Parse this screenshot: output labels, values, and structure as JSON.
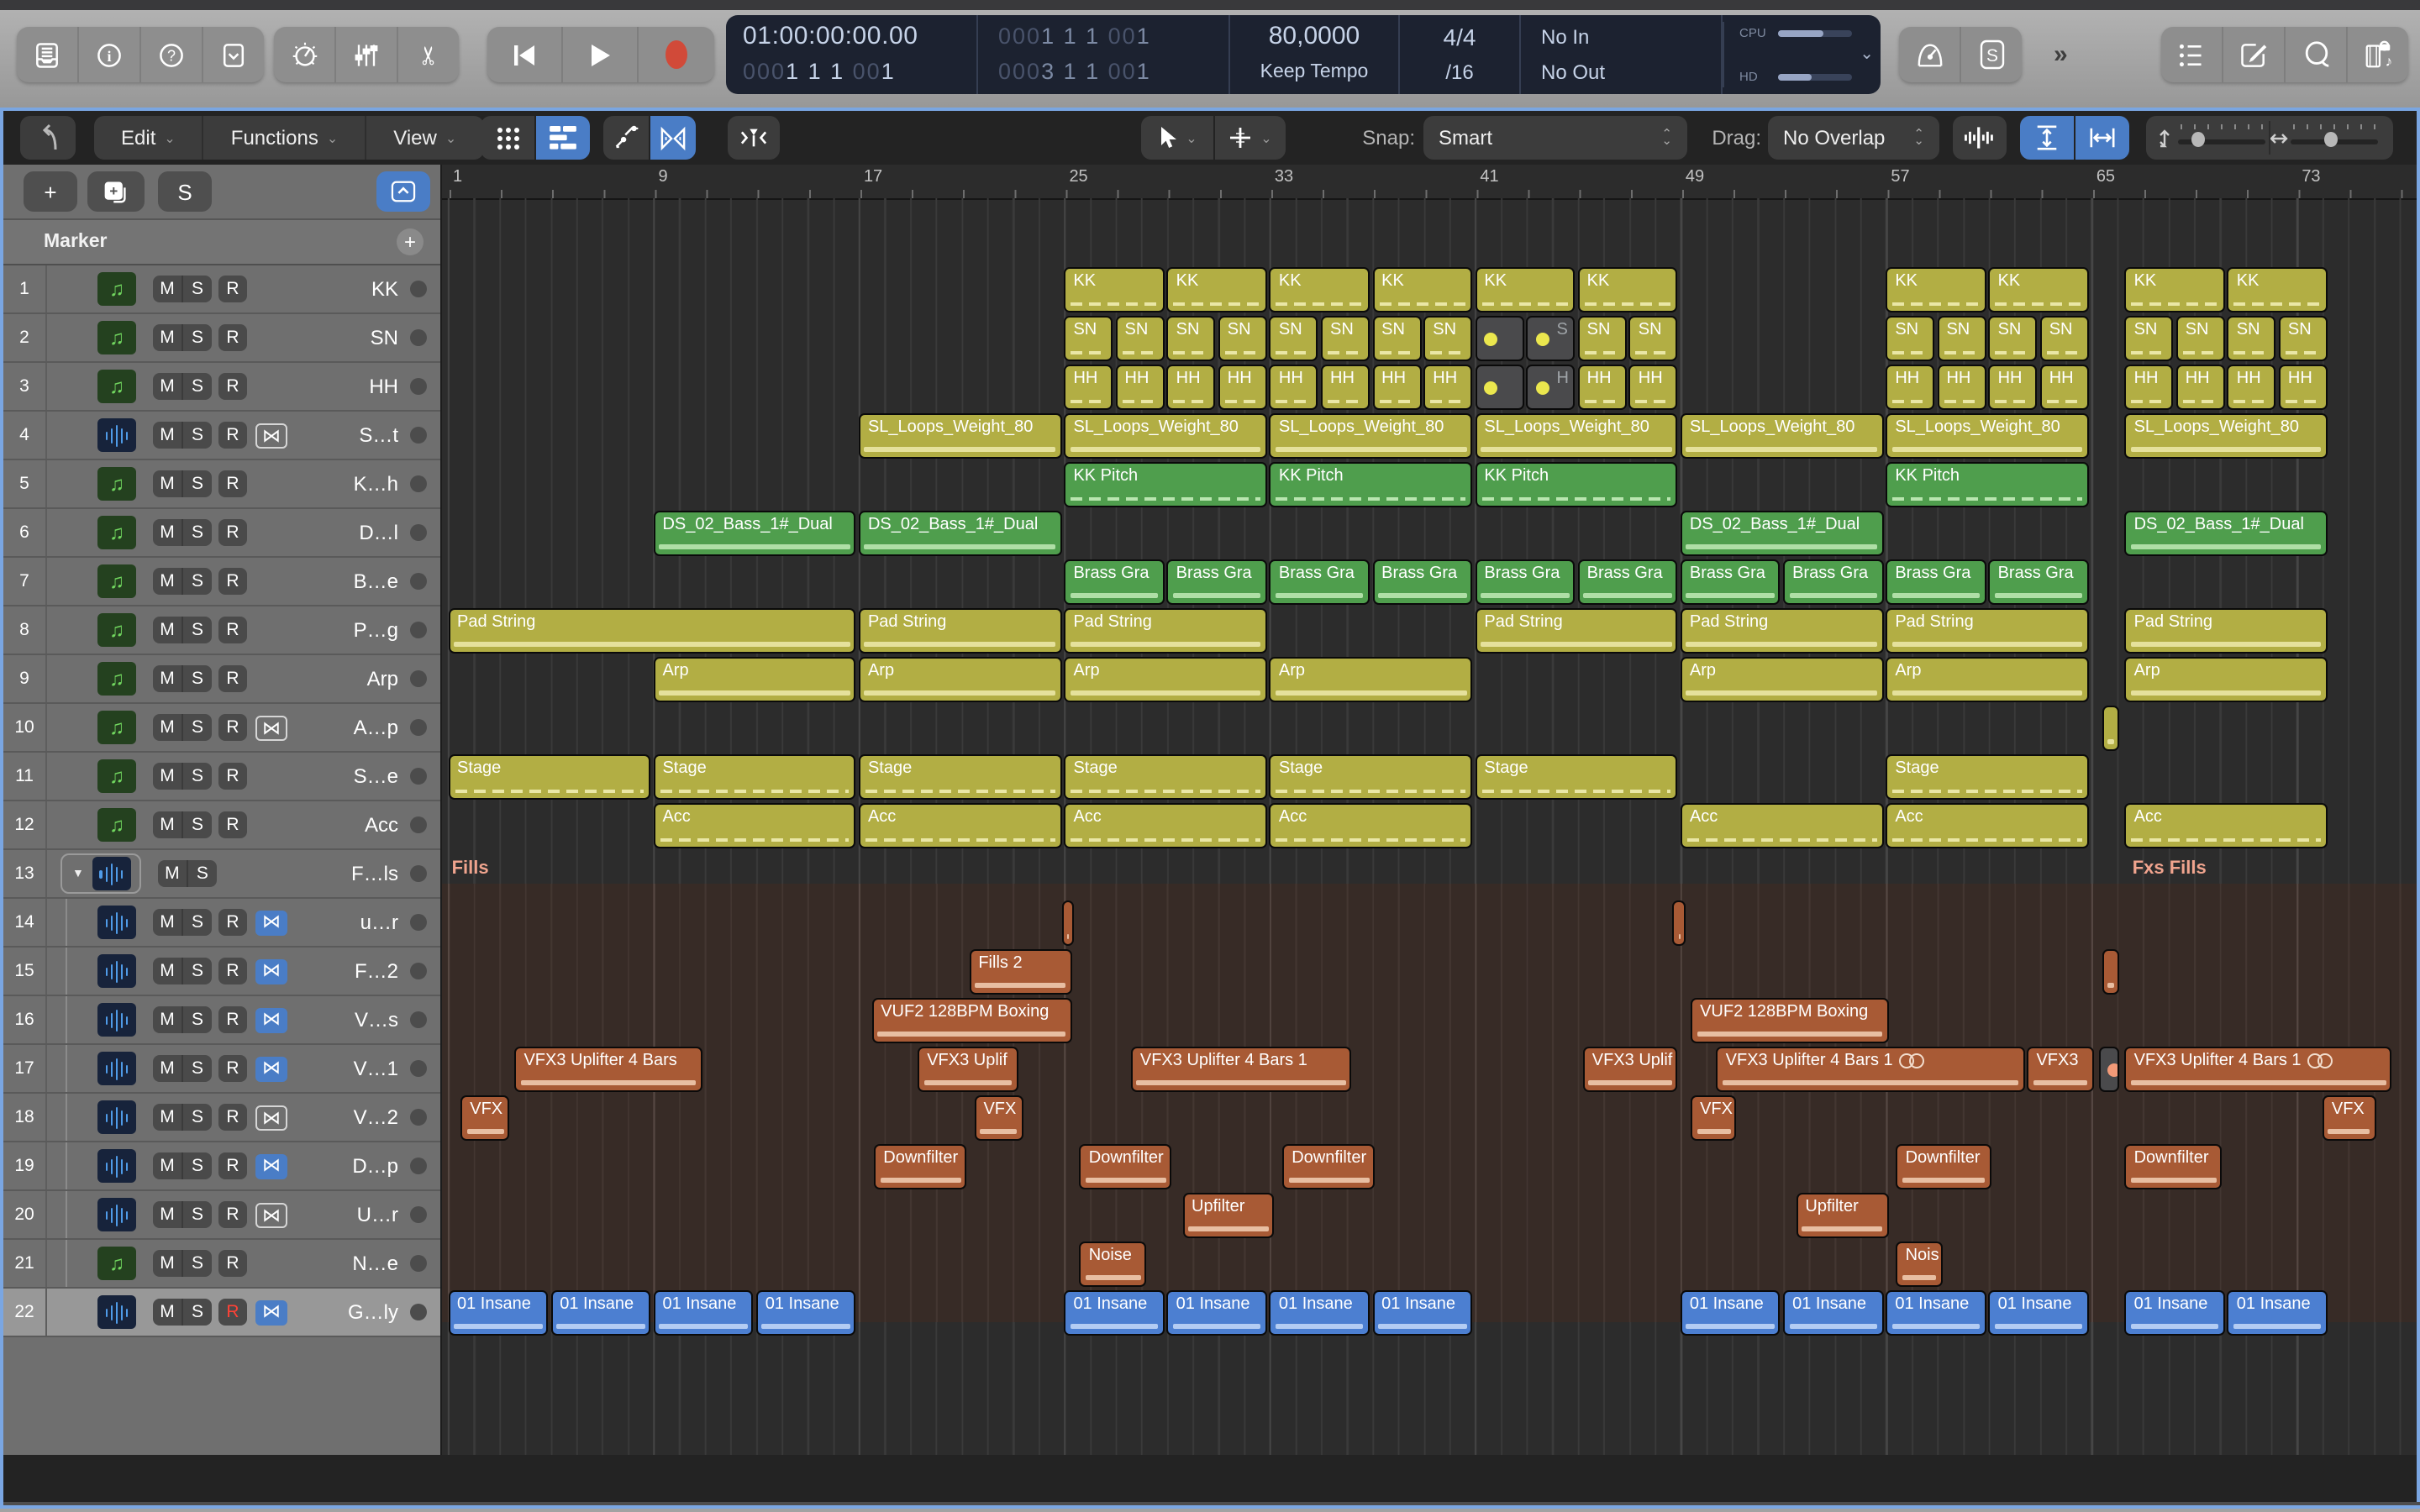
{
  "toolbar": {
    "overflow": "»",
    "solo_badge": "S",
    "lcd": {
      "time": "01:00:00:00.00",
      "pos": {
        "d1": "000",
        "b1": "1 1 1 ",
        "d2": "00",
        "b2": "1"
      },
      "alt_top": {
        "d1": "000",
        "m1": "1 1 1 ",
        "d2": "00",
        "m2": "1"
      },
      "alt_bot": {
        "d1": "000",
        "m1": "3 1 1 ",
        "d2": "00",
        "m2": "1"
      },
      "tempo_value": "80,0000",
      "tempo_mode": "Keep Tempo",
      "sig_top": "4/4",
      "sig_bottom": "/16",
      "io_in": "No In",
      "io_out": "No Out",
      "cpu_label": "CPU",
      "hd_label": "HD"
    }
  },
  "toolbar2": {
    "menus": [
      {
        "label": "Edit"
      },
      {
        "label": "Functions"
      },
      {
        "label": "View"
      }
    ],
    "snap_label": "Snap:",
    "snap_value": "Smart",
    "drag_label": "Drag:",
    "drag_value": "No Overlap"
  },
  "panel": {
    "marker_label": "Marker"
  },
  "ruler": {
    "bar_numbers": [
      1,
      9,
      17,
      25,
      33,
      41,
      49,
      57,
      65,
      73
    ]
  },
  "arrange": {
    "bar_width": 15.28,
    "first_bar_x": 3.5,
    "folder_labels": [
      {
        "text": "Fills",
        "bar": 1.15
      },
      {
        "text": "Fxs Fills",
        "bar": 66.6
      }
    ]
  },
  "colors": {
    "accent_blue": "#4a7dc6",
    "focus_border": "#7aa6e2",
    "clip_yellow": "#b2ae44",
    "clip_green": "#4f9e4d",
    "clip_rust": "#a85a35",
    "clip_blue": "#4c7fd1",
    "muted_dot_yellow": "#ebe74e",
    "muted_dot_orange": "#f29a78",
    "record_red": "#ff4236"
  },
  "tracks": [
    {
      "num": 1,
      "name": "KK",
      "kind": "midi",
      "r": true,
      "cc": "y",
      "st": "dash",
      "clips": [
        {
          "s": 25,
          "e": 29,
          "l": "KK"
        },
        {
          "s": 29,
          "e": 33,
          "l": "KK"
        },
        {
          "s": 33,
          "e": 37,
          "l": "KK"
        },
        {
          "s": 37,
          "e": 41,
          "l": "KK"
        },
        {
          "s": 41,
          "e": 45,
          "l": "KK"
        },
        {
          "s": 45,
          "e": 49,
          "l": "KK"
        },
        {
          "s": 57,
          "e": 61,
          "l": "KK"
        },
        {
          "s": 61,
          "e": 65,
          "l": "KK"
        },
        {
          "s": 66.3,
          "e": 70.3,
          "l": "KK"
        },
        {
          "s": 70.3,
          "e": 74.3,
          "l": "KK"
        }
      ]
    },
    {
      "num": 2,
      "name": "SN",
      "kind": "midi",
      "r": true,
      "cc": "y",
      "st": "dash",
      "clips": [
        {
          "s": 25,
          "e": 27,
          "l": "SN"
        },
        {
          "s": 27,
          "e": 29,
          "l": "SN"
        },
        {
          "s": 29,
          "e": 31,
          "l": "SN"
        },
        {
          "s": 31,
          "e": 33,
          "l": "SN"
        },
        {
          "s": 33,
          "e": 35,
          "l": "SN"
        },
        {
          "s": 35,
          "e": 37,
          "l": "SN"
        },
        {
          "s": 37,
          "e": 39,
          "l": "SN"
        },
        {
          "s": 39,
          "e": 41,
          "l": "SN"
        },
        {
          "s": 41,
          "e": 43,
          "muted": true,
          "dot": "#ebe74e"
        },
        {
          "s": 43,
          "e": 45,
          "muted": true,
          "dot": "#ebe74e",
          "l": "S"
        },
        {
          "s": 45,
          "e": 47,
          "l": "SN"
        },
        {
          "s": 47,
          "e": 49,
          "l": "SN"
        },
        {
          "s": 57,
          "e": 59,
          "l": "SN"
        },
        {
          "s": 59,
          "e": 61,
          "l": "SN"
        },
        {
          "s": 61,
          "e": 63,
          "l": "SN"
        },
        {
          "s": 63,
          "e": 65,
          "l": "SN"
        },
        {
          "s": 66.3,
          "e": 68.3,
          "l": "SN"
        },
        {
          "s": 68.3,
          "e": 70.3,
          "l": "SN"
        },
        {
          "s": 70.3,
          "e": 72.3,
          "l": "SN"
        },
        {
          "s": 72.3,
          "e": 74.3,
          "l": "SN"
        }
      ]
    },
    {
      "num": 3,
      "name": "HH",
      "kind": "midi",
      "r": true,
      "cc": "y",
      "st": "dash",
      "clips": [
        {
          "s": 25,
          "e": 27,
          "l": "HH"
        },
        {
          "s": 27,
          "e": 29,
          "l": "HH"
        },
        {
          "s": 29,
          "e": 31,
          "l": "HH"
        },
        {
          "s": 31,
          "e": 33,
          "l": "HH"
        },
        {
          "s": 33,
          "e": 35,
          "l": "HH"
        },
        {
          "s": 35,
          "e": 37,
          "l": "HH"
        },
        {
          "s": 37,
          "e": 39,
          "l": "HH"
        },
        {
          "s": 39,
          "e": 41,
          "l": "HH"
        },
        {
          "s": 41,
          "e": 43,
          "muted": true,
          "dot": "#ebe74e"
        },
        {
          "s": 43,
          "e": 45,
          "muted": true,
          "dot": "#ebe74e",
          "l": "H"
        },
        {
          "s": 45,
          "e": 47,
          "l": "HH"
        },
        {
          "s": 47,
          "e": 49,
          "l": "HH"
        },
        {
          "s": 57,
          "e": 59,
          "l": "HH"
        },
        {
          "s": 59,
          "e": 61,
          "l": "HH"
        },
        {
          "s": 61,
          "e": 63,
          "l": "HH"
        },
        {
          "s": 63,
          "e": 65,
          "l": "HH"
        },
        {
          "s": 66.3,
          "e": 68.3,
          "l": "HH"
        },
        {
          "s": 68.3,
          "e": 70.3,
          "l": "HH"
        },
        {
          "s": 70.3,
          "e": 72.3,
          "l": "HH"
        },
        {
          "s": 72.3,
          "e": 74.3,
          "l": "HH"
        }
      ]
    },
    {
      "num": 4,
      "name": "S…t",
      "kind": "audio",
      "r": true,
      "flex": "plain",
      "cc": "y",
      "st": "wave",
      "clips": [
        {
          "s": 17,
          "e": 25,
          "l": "SL_Loops_Weight_80"
        },
        {
          "s": 25,
          "e": 33,
          "l": "SL_Loops_Weight_80"
        },
        {
          "s": 33,
          "e": 41,
          "l": "SL_Loops_Weight_80"
        },
        {
          "s": 41,
          "e": 49,
          "l": "SL_Loops_Weight_80"
        },
        {
          "s": 49,
          "e": 57,
          "l": "SL_Loops_Weight_80"
        },
        {
          "s": 57,
          "e": 65,
          "l": "SL_Loops_Weight_80"
        },
        {
          "s": 66.3,
          "e": 74.3,
          "l": "SL_Loops_Weight_80"
        }
      ]
    },
    {
      "num": 5,
      "name": "K…h",
      "kind": "midi",
      "r": true,
      "cc": "g",
      "st": "dash",
      "clips": [
        {
          "s": 25,
          "e": 33,
          "l": "KK Pitch"
        },
        {
          "s": 33,
          "e": 41,
          "l": "KK Pitch"
        },
        {
          "s": 41,
          "e": 49,
          "l": "KK Pitch"
        },
        {
          "s": 57,
          "e": 65,
          "l": "KK Pitch"
        }
      ]
    },
    {
      "num": 6,
      "name": "D…l",
      "kind": "midi",
      "r": true,
      "cc": "g",
      "st": "wave",
      "clips": [
        {
          "s": 9,
          "e": 17,
          "l": "DS_02_Bass_1#_Dual"
        },
        {
          "s": 17,
          "e": 25,
          "l": "DS_02_Bass_1#_Dual"
        },
        {
          "s": 49,
          "e": 57,
          "l": "DS_02_Bass_1#_Dual"
        },
        {
          "s": 66.3,
          "e": 74.3,
          "l": "DS_02_Bass_1#_Dual"
        }
      ]
    },
    {
      "num": 7,
      "name": "B…e",
      "kind": "midi",
      "r": true,
      "cc": "g",
      "st": "wave",
      "clips": [
        {
          "s": 25,
          "e": 29,
          "l": "Brass Gra"
        },
        {
          "s": 29,
          "e": 33,
          "l": "Brass Gra"
        },
        {
          "s": 33,
          "e": 37,
          "l": "Brass Gra"
        },
        {
          "s": 37,
          "e": 41,
          "l": "Brass Gra"
        },
        {
          "s": 41,
          "e": 45,
          "l": "Brass Gra"
        },
        {
          "s": 45,
          "e": 49,
          "l": "Brass Gra"
        },
        {
          "s": 49,
          "e": 53,
          "l": "Brass Gra"
        },
        {
          "s": 53,
          "e": 57,
          "l": "Brass Gra"
        },
        {
          "s": 57,
          "e": 61,
          "l": "Brass Gra"
        },
        {
          "s": 61,
          "e": 65,
          "l": "Brass Gra"
        }
      ]
    },
    {
      "num": 8,
      "name": "P…g",
      "kind": "midi",
      "r": true,
      "cc": "y",
      "st": "wave",
      "clips": [
        {
          "s": 1,
          "e": 17,
          "l": "Pad String"
        },
        {
          "s": 17,
          "e": 25,
          "l": "Pad String"
        },
        {
          "s": 25,
          "e": 33,
          "l": "Pad String"
        },
        {
          "s": 41,
          "e": 49,
          "l": "Pad String"
        },
        {
          "s": 49,
          "e": 57,
          "l": "Pad String"
        },
        {
          "s": 57,
          "e": 65,
          "l": "Pad String"
        },
        {
          "s": 66.3,
          "e": 74.3,
          "l": "Pad String"
        }
      ]
    },
    {
      "num": 9,
      "name": "Arp",
      "kind": "midi",
      "r": true,
      "cc": "y",
      "st": "wave",
      "clips": [
        {
          "s": 9,
          "e": 17,
          "l": "Arp"
        },
        {
          "s": 17,
          "e": 25,
          "l": "Arp"
        },
        {
          "s": 25,
          "e": 33,
          "l": "Arp"
        },
        {
          "s": 33,
          "e": 41,
          "l": "Arp"
        },
        {
          "s": 49,
          "e": 57,
          "l": "Arp"
        },
        {
          "s": 57,
          "e": 65,
          "l": "Arp"
        },
        {
          "s": 66.3,
          "e": 74.3,
          "l": "Arp"
        }
      ]
    },
    {
      "num": 10,
      "name": "A…p",
      "kind": "midi",
      "r": true,
      "flex": "plain",
      "cc": "y",
      "st": "wave",
      "clips": [
        {
          "s": 65.4,
          "e": 66.2
        }
      ]
    },
    {
      "num": 11,
      "name": "S…e",
      "kind": "midi",
      "r": true,
      "cc": "y",
      "st": "dash",
      "clips": [
        {
          "s": 1,
          "e": 9,
          "l": "Stage"
        },
        {
          "s": 9,
          "e": 17,
          "l": "Stage"
        },
        {
          "s": 17,
          "e": 25,
          "l": "Stage"
        },
        {
          "s": 25,
          "e": 33,
          "l": "Stage"
        },
        {
          "s": 33,
          "e": 41,
          "l": "Stage"
        },
        {
          "s": 41,
          "e": 49,
          "l": "Stage"
        },
        {
          "s": 57,
          "e": 65,
          "l": "Stage"
        }
      ]
    },
    {
      "num": 12,
      "name": "Acc",
      "kind": "midi",
      "r": true,
      "cc": "y",
      "st": "dash",
      "clips": [
        {
          "s": 9,
          "e": 17,
          "l": "Acc"
        },
        {
          "s": 17,
          "e": 25,
          "l": "Acc"
        },
        {
          "s": 25,
          "e": 33,
          "l": "Acc"
        },
        {
          "s": 33,
          "e": 41,
          "l": "Acc"
        },
        {
          "s": 49,
          "e": 57,
          "l": "Acc"
        },
        {
          "s": 57,
          "e": 65,
          "l": "Acc"
        },
        {
          "s": 66.3,
          "e": 74.3,
          "l": "Acc"
        }
      ]
    },
    {
      "num": 13,
      "name": "F…ls",
      "kind": "folder",
      "r": false,
      "cc": "o",
      "st": "wave",
      "clips": []
    },
    {
      "num": 14,
      "name": "u…r",
      "kind": "audio",
      "sub": true,
      "r": true,
      "flex": "blue",
      "cc": "o",
      "st": "wave",
      "clips": [
        {
          "s": 24.9,
          "e": 25.5
        },
        {
          "s": 48.7,
          "e": 49.3
        }
      ]
    },
    {
      "num": 15,
      "name": "F…2",
      "kind": "audio",
      "sub": true,
      "r": true,
      "flex": "blue",
      "cc": "o",
      "st": "wave",
      "clips": [
        {
          "s": 21.3,
          "e": 25.4,
          "l": "Fills 2"
        },
        {
          "s": 65.4,
          "e": 66.2
        }
      ]
    },
    {
      "num": 16,
      "name": "V…s",
      "kind": "audio",
      "sub": true,
      "r": true,
      "flex": "blue",
      "cc": "o",
      "st": "wave",
      "clips": [
        {
          "s": 17.5,
          "e": 25.4,
          "l": "VUF2 128BPM Boxing"
        },
        {
          "s": 49.4,
          "e": 57.2,
          "l": "VUF2 128BPM Boxing"
        }
      ]
    },
    {
      "num": 17,
      "name": "V…1",
      "kind": "audio",
      "sub": true,
      "r": true,
      "flex": "blue",
      "cc": "o",
      "st": "wave",
      "clips": [
        {
          "s": 3.6,
          "e": 11,
          "l": "VFX3 Uplifter 4 Bars"
        },
        {
          "s": 19.3,
          "e": 23.3,
          "l": "VFX3 Uplif"
        },
        {
          "s": 27.6,
          "e": 36.3,
          "l": "VFX3 Uplifter 4 Bars 1"
        },
        {
          "s": 45.2,
          "e": 49,
          "l": "VFX3 Uplif"
        },
        {
          "s": 50.4,
          "e": 62.5,
          "l": "VFX3 Uplifter 4 Bars 1",
          "loop": true
        },
        {
          "s": 62.5,
          "e": 65.2,
          "l": "VFX3"
        },
        {
          "s": 65.3,
          "e": 66.2,
          "muted": true,
          "dot": "#f29a78"
        },
        {
          "s": 66.3,
          "e": 76.8,
          "l": "VFX3 Uplifter 4 Bars 1",
          "loop": true
        }
      ]
    },
    {
      "num": 18,
      "name": "V…2",
      "kind": "audio",
      "sub": true,
      "r": true,
      "flex": "plain",
      "cc": "o",
      "st": "wave",
      "clips": [
        {
          "s": 1.5,
          "e": 3.5,
          "l": "VFX"
        },
        {
          "s": 21.5,
          "e": 23.5,
          "l": "VFX"
        },
        {
          "s": 49.4,
          "e": 51.3,
          "l": "VFX"
        },
        {
          "s": 74,
          "e": 76.2,
          "l": "VFX"
        }
      ]
    },
    {
      "num": 19,
      "name": "D…p",
      "kind": "audio",
      "sub": true,
      "r": true,
      "flex": "blue",
      "cc": "o",
      "st": "wave",
      "clips": [
        {
          "s": 17.6,
          "e": 21.3,
          "l": "Downfilter"
        },
        {
          "s": 25.6,
          "e": 29.3,
          "l": "Downfilter"
        },
        {
          "s": 33.5,
          "e": 37.2,
          "l": "Downfilter"
        },
        {
          "s": 57.4,
          "e": 61.2,
          "l": "Downfilter"
        },
        {
          "s": 66.3,
          "e": 70.2,
          "l": "Downfilter"
        }
      ]
    },
    {
      "num": 20,
      "name": "U…r",
      "kind": "audio",
      "sub": true,
      "r": true,
      "flex": "plain",
      "cc": "o",
      "st": "wave",
      "clips": [
        {
          "s": 29.6,
          "e": 33.3,
          "l": "Upfilter"
        },
        {
          "s": 53.5,
          "e": 57.2,
          "l": "Upfilter"
        }
      ]
    },
    {
      "num": 21,
      "name": "N…e",
      "kind": "midi",
      "sub": true,
      "r": true,
      "cc": "o",
      "st": "wave",
      "clips": [
        {
          "s": 25.6,
          "e": 28.3,
          "l": "Noise"
        },
        {
          "s": 57.4,
          "e": 59.3,
          "l": "Nois"
        }
      ]
    },
    {
      "num": 22,
      "name": "G…ly",
      "kind": "audio",
      "r": true,
      "rRed": true,
      "flex": "blue",
      "selected": true,
      "cc": "b",
      "st": "wave",
      "clips": [
        {
          "s": 1,
          "e": 5,
          "l": "01 Insane"
        },
        {
          "s": 5,
          "e": 9,
          "l": "01 Insane"
        },
        {
          "s": 9,
          "e": 13,
          "l": "01 Insane"
        },
        {
          "s": 13,
          "e": 17,
          "l": "01 Insane"
        },
        {
          "s": 25,
          "e": 29,
          "l": "01 Insane"
        },
        {
          "s": 29,
          "e": 33,
          "l": "01 Insane"
        },
        {
          "s": 33,
          "e": 37,
          "l": "01 Insane"
        },
        {
          "s": 37,
          "e": 41,
          "l": "01 Insane"
        },
        {
          "s": 49,
          "e": 53,
          "l": "01 Insane"
        },
        {
          "s": 53,
          "e": 57,
          "l": "01 Insane"
        },
        {
          "s": 57,
          "e": 61,
          "l": "01 Insane"
        },
        {
          "s": 61,
          "e": 65,
          "l": "01 Insane"
        },
        {
          "s": 66.3,
          "e": 70.3,
          "l": "01 Insane"
        },
        {
          "s": 70.3,
          "e": 74.3,
          "l": "01 Insane"
        }
      ]
    }
  ]
}
